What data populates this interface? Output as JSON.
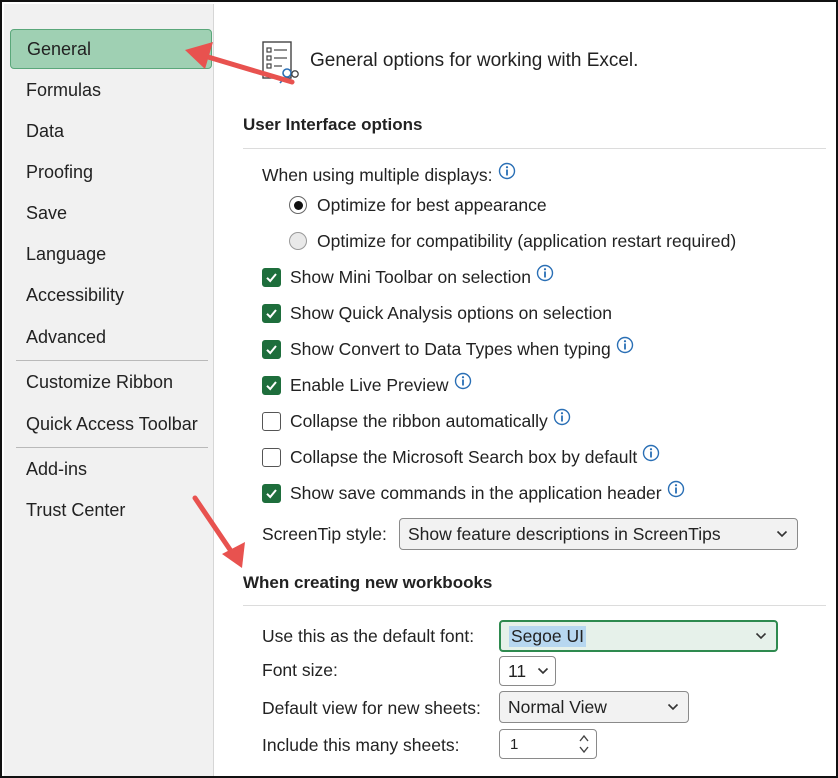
{
  "sidebar": {
    "items": [
      {
        "label": "General",
        "active": true
      },
      {
        "label": "Formulas"
      },
      {
        "label": "Data"
      },
      {
        "label": "Proofing"
      },
      {
        "label": "Save"
      },
      {
        "label": "Language"
      },
      {
        "label": "Accessibility"
      },
      {
        "label": "Advanced"
      },
      {
        "label": "Customize Ribbon"
      },
      {
        "label": "Quick Access Toolbar"
      },
      {
        "label": "Add-ins"
      },
      {
        "label": "Trust Center"
      }
    ]
  },
  "header": {
    "text": "General options for working with Excel.",
    "icon": "options-checklist-icon"
  },
  "ui_options": {
    "title": "User Interface options",
    "multi_display_label": "When using multiple displays:",
    "radio_best": {
      "label": "Optimize for best appearance",
      "checked": true
    },
    "radio_compat": {
      "label": "Optimize for compatibility (application restart required)",
      "checked": false
    },
    "checkboxes": [
      {
        "label": "Show Mini Toolbar on selection",
        "checked": true,
        "info": true
      },
      {
        "label": "Show Quick Analysis options on selection",
        "checked": true,
        "info": false
      },
      {
        "label": "Show Convert to Data Types when typing",
        "checked": true,
        "info": true
      },
      {
        "label": "Enable Live Preview",
        "checked": true,
        "info": true
      },
      {
        "label": "Collapse the ribbon automatically",
        "checked": false,
        "info": true
      },
      {
        "label": "Collapse the Microsoft Search box by default",
        "checked": false,
        "info": true
      },
      {
        "label": "Show save commands in the application header",
        "checked": true,
        "info": true
      }
    ],
    "screentip_label": "ScreenTip style:",
    "screentip_value": "Show feature descriptions in ScreenTips"
  },
  "new_workbooks": {
    "title": "When creating new workbooks",
    "font_label": "Use this as the default font:",
    "font_value": "Segoe UI",
    "size_label": "Font size:",
    "size_value": "11",
    "view_label": "Default view for new sheets:",
    "view_value": "Normal View",
    "sheets_label": "Include this many sheets:",
    "sheets_value": "1"
  },
  "colors": {
    "accent": "#1e6e3c",
    "active_nav": "#9fd0b3",
    "arrow": "#e8524f"
  }
}
